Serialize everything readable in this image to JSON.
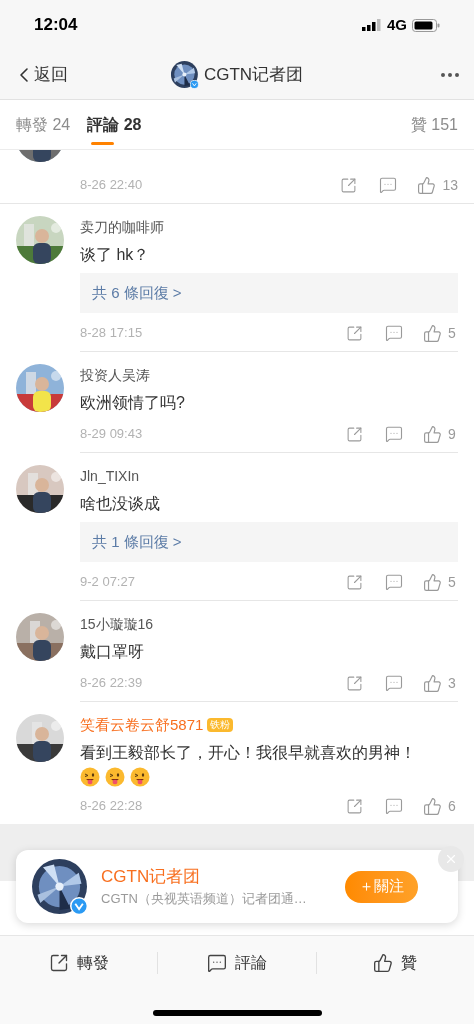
{
  "status_bar": {
    "time": "12:04",
    "network": "4G"
  },
  "nav": {
    "back": "返回",
    "title": "CGTN记者团",
    "verified": true
  },
  "tabs": [
    {
      "label": "轉發",
      "count": "24",
      "selected": false
    },
    {
      "label": "評論",
      "count": "28",
      "selected": true
    }
  ],
  "likes_tab": {
    "label": "贊",
    "count": "151"
  },
  "comments": [
    {
      "kind": "cut",
      "time": "8-26 22:40",
      "likes": "13"
    },
    {
      "kind": "full",
      "name": "卖刀的咖啡师",
      "vip": false,
      "text": "谈了 hk？",
      "replies": "共 6 條回復 >",
      "time": "8-28 17:15",
      "likes": "5"
    },
    {
      "kind": "full",
      "name": "投资人吴涛",
      "vip": false,
      "text": "欧洲领情了吗?",
      "time": "8-29 09:43",
      "likes": "9"
    },
    {
      "kind": "full",
      "name": "Jln_TIXIn",
      "vip": false,
      "text": "啥也没谈成",
      "replies": "共 1 條回復 >",
      "time": "9-2 07:27",
      "likes": "5"
    },
    {
      "kind": "full",
      "name": "15小璇璇16",
      "vip": false,
      "text": "戴口罩呀",
      "time": "8-26 22:39",
      "likes": "3"
    },
    {
      "kind": "full",
      "name": "笑看云卷云舒5871",
      "vip": true,
      "badge": "铁粉",
      "text": "看到王毅部长了，开心！我很早就喜欢的男神！",
      "stickers": [
        {
          "kind": "tongue"
        },
        {
          "kind": "tongue"
        },
        {
          "kind": "tongue"
        }
      ],
      "time": "8-26 22:28",
      "likes": "6"
    }
  ],
  "follow_card": {
    "name": "CGTN记者团",
    "verified": true,
    "description": "CGTN（央视英语频道）记者团通…",
    "button": "＋關注"
  },
  "bottom_bar": [
    {
      "kind": "repost",
      "label": "轉發"
    },
    {
      "kind": "comment",
      "label": "評論"
    },
    {
      "kind": "like",
      "label": "贊"
    }
  ]
}
